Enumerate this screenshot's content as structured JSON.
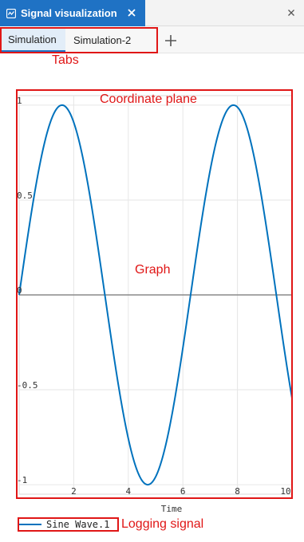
{
  "panel": {
    "title": "Signal visualization"
  },
  "tabs": [
    {
      "label": "Simulation",
      "active": true
    },
    {
      "label": "Simulation-2",
      "active": false
    }
  ],
  "annotations": {
    "tabs": "Tabs",
    "coordinate_plane": "Coordinate plane",
    "graph": "Graph",
    "logging_signal": "Logging signal"
  },
  "legend": {
    "label": "Sine Wave.1",
    "color": "#0072bd"
  },
  "chart_data": {
    "type": "line",
    "xlabel": "Time",
    "ylabel": "",
    "xlim": [
      0,
      10
    ],
    "ylim": [
      -1.05,
      1.05
    ],
    "xticks": [
      2,
      4,
      6,
      8,
      10
    ],
    "yticks": [
      1,
      0.5,
      0,
      -0.5,
      -1
    ],
    "ytick_labels": [
      "1",
      "0.5",
      "0",
      "-0.5",
      "-1"
    ],
    "grid": true,
    "series": [
      {
        "name": "Sine Wave.1",
        "color": "#0072bd",
        "function": "sin",
        "x_start": 0,
        "x_end": 10
      }
    ]
  }
}
